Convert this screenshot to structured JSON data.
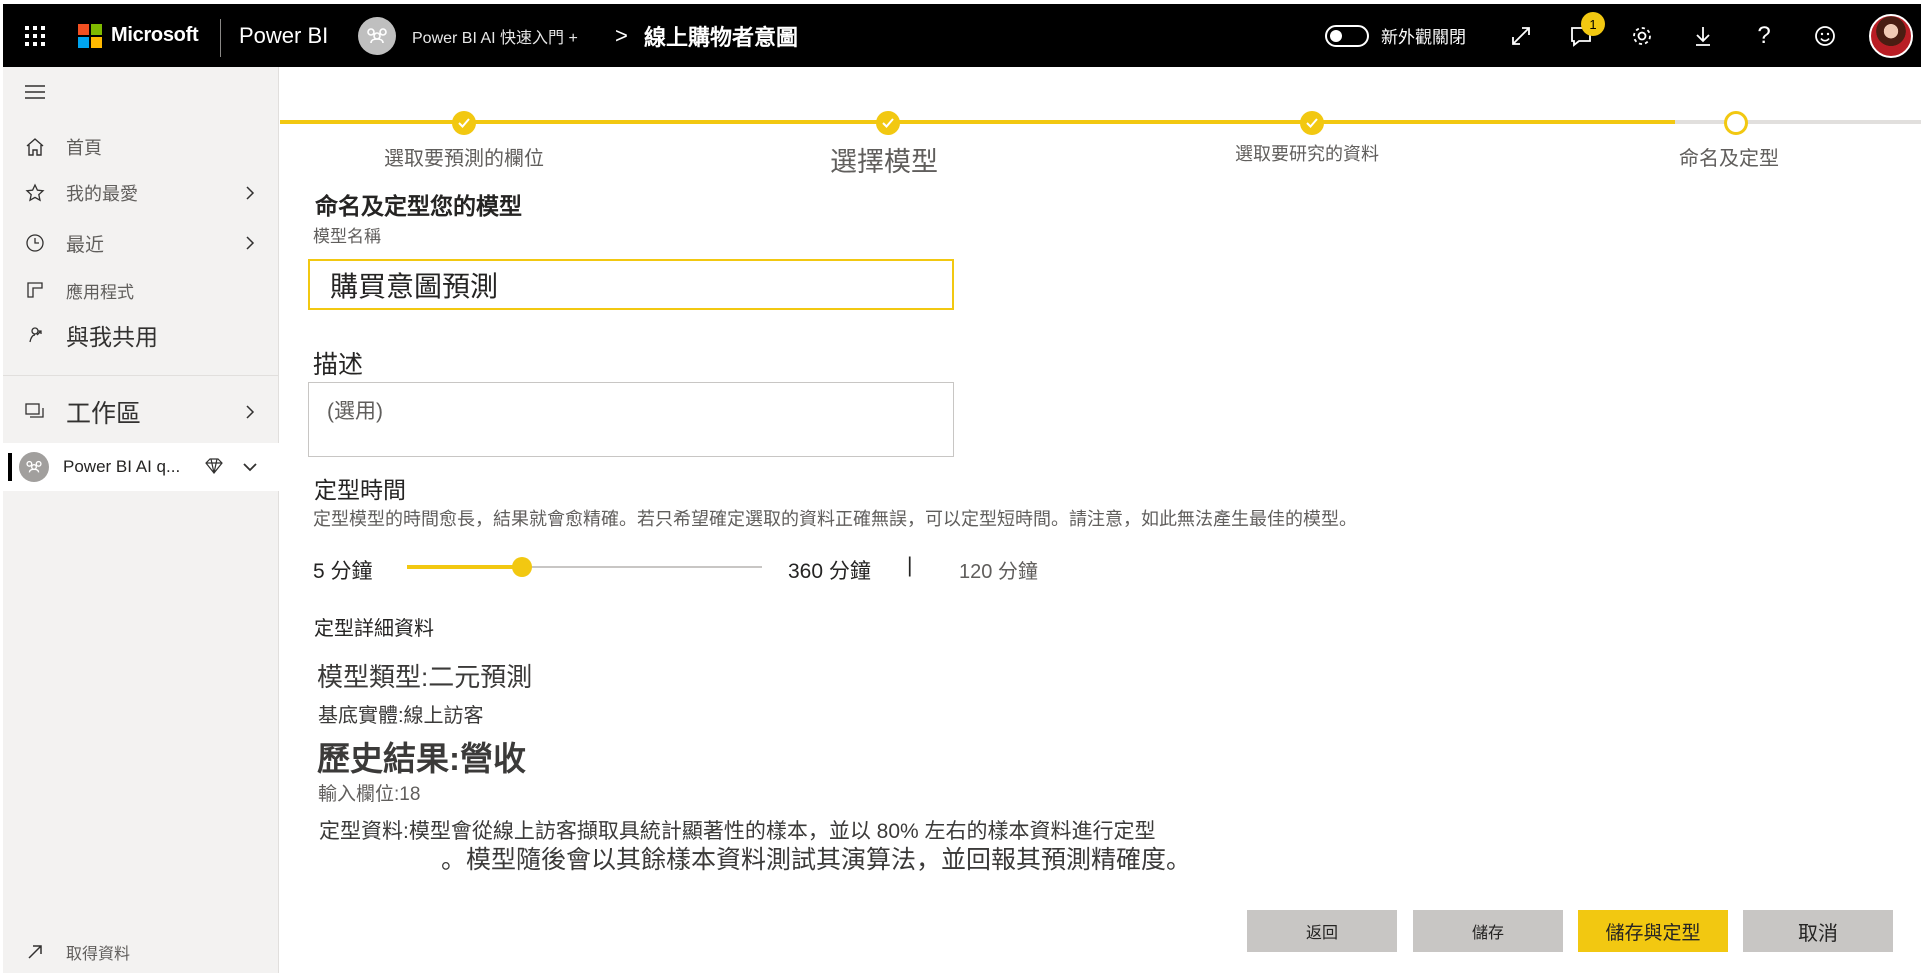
{
  "topbar": {
    "brand": "Microsoft",
    "product": "Power BI",
    "workspace_name": "Power BI AI 快速入門 +",
    "breadcrumb_separator": ">",
    "report_title": "線上購物者意圖",
    "new_look_toggle_label": "新外觀關閉",
    "notification_count": "1",
    "icons": [
      "app-launcher-icon",
      "expand-icon",
      "notification-icon",
      "settings-icon",
      "download-icon",
      "help-icon",
      "feedback-smiley-icon",
      "user-avatar"
    ],
    "logo_colors": [
      "#f25022",
      "#7fba00",
      "#00a4ef",
      "#ffb900"
    ]
  },
  "sidebar": {
    "items": [
      {
        "label": "首頁",
        "icon": "home-icon"
      },
      {
        "label": "我的最愛",
        "icon": "star-icon"
      },
      {
        "label": "最近",
        "icon": "clock-icon"
      },
      {
        "label": "應用程式",
        "icon": "apps-icon"
      },
      {
        "label": "與我共用",
        "icon": "shared-icon"
      },
      {
        "label": "工作區",
        "icon": "workspaces-icon"
      }
    ],
    "current_workspace": "Power BI AI q...",
    "get_data": "取得資料"
  },
  "wizard": {
    "steps": [
      {
        "label": "選取要預測的欄位",
        "state": "done"
      },
      {
        "label": "選擇模型",
        "state": "done"
      },
      {
        "label": "選取要研究的資料",
        "state": "done"
      },
      {
        "label": "命名及定型",
        "state": "current"
      }
    ],
    "progress_fraction": 0.85
  },
  "form": {
    "title": "命名及定型您的模型",
    "model_name_label": "模型名稱",
    "model_name_value": "購買意圖預測",
    "description_label": "描述",
    "description_placeholder": "(選用)",
    "training_time_label": "定型時間",
    "training_time_help": "定型模型的時間愈長，結果就會愈精確。若只希望確定選取的資料正確無誤，可以定型短時間。請注意，如此無法產生最佳的模型。",
    "slider_min_label": "5 分鐘",
    "slider_max_label": "360 分鐘",
    "slider_separator": "|",
    "slider_value_label": "120 分鐘",
    "slider_min": 5,
    "slider_max": 360,
    "slider_value": 120
  },
  "details": {
    "heading": "定型詳細資料",
    "model_type": "模型類型:二元預測",
    "base_entity": "基底實體:線上訪客",
    "historical_outcome": "歷史結果:營收",
    "input_fields": "輸入欄位:18",
    "training_data_line1": "定型資料:模型會從線上訪客擷取具統計顯著性的樣本，並以 80% 左右的樣本資料進行定型",
    "training_data_line2": "。模型隨後會以其餘樣本資料測試其演算法，並回報其預測精確度。"
  },
  "buttons": {
    "back": "返回",
    "save": "儲存",
    "save_and_train": "儲存與定型",
    "cancel": "取消"
  },
  "colors": {
    "accent": "#f2c811",
    "topbar": "#000000",
    "sidebar": "#f3f2f1"
  }
}
